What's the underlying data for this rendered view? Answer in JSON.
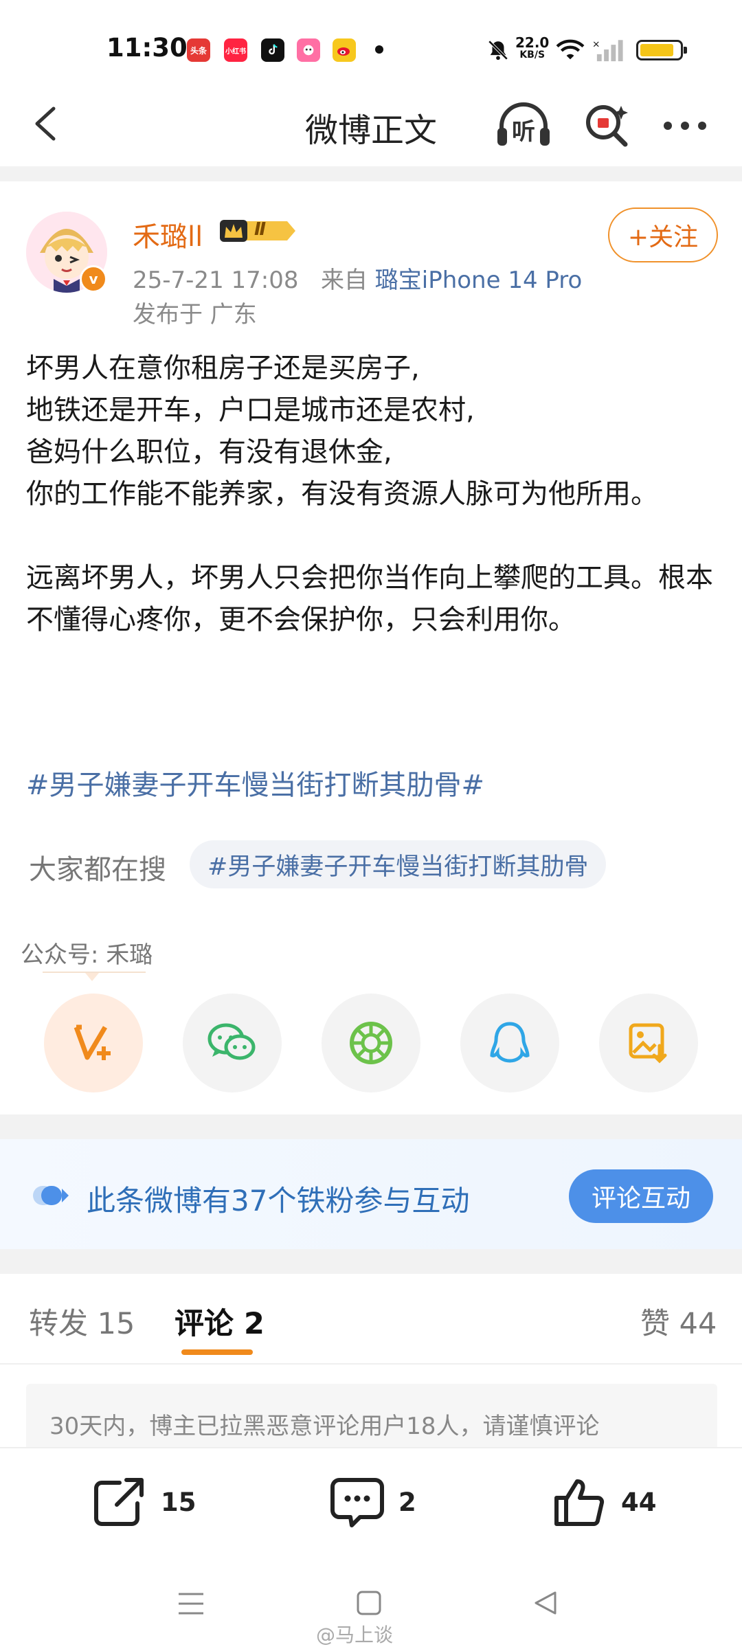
{
  "status_bar": {
    "time": "11:30",
    "apps": [
      "头条",
      "小红书"
    ],
    "speed_value": "22.0",
    "speed_unit": "KB/S",
    "battery_level": 0.85,
    "battery_color": "#f5c518"
  },
  "nav": {
    "title": "微博正文",
    "back_icon": "chevron-left-icon",
    "listen_label": "听",
    "more_icon": "more-dots-icon"
  },
  "post": {
    "username": "禾璐ll",
    "level_badge": "Ⅱ",
    "verified_badge": "v",
    "time": "25-7-21 17:08",
    "source_prefix": "来自",
    "source": "璐宝iPhone 14 Pro",
    "location": "发布于 广东",
    "follow_label": "+关注",
    "body": "坏男人在意你租房子还是买房子,\n地铁还是开车，户口是城市还是农村,\n爸妈什么职位，有没有退休金,\n你的工作能不能养家，有没有资源人脉可为他所用。\n\n远离坏男人，坏男人只会把你当作向上攀爬的工具。根本不懂得心疼你，更不会保护你，只会利用你。",
    "topic": "#男子嫌妻子开车慢当街打断其肋骨#",
    "search_label": "大家都在搜",
    "search_chip": "#男子嫌妻子开车慢当街打断其肋骨",
    "public_account": "公众号: 禾璐"
  },
  "share_icons": [
    "weibo-share-icon",
    "wechat-icon",
    "moments-icon",
    "qq-icon",
    "save-image-icon"
  ],
  "fans_banner": {
    "text": "此条微博有37个铁粉参与互动",
    "button": "评论互动"
  },
  "tabs": {
    "repost": "转发 15",
    "comment": "评论 2",
    "like": "赞 44"
  },
  "notice": "30天内，博主已拉黑恶意评论用户18人，请谨慎评论",
  "actions": {
    "repost_count": "15",
    "comment_count": "2",
    "like_count": "44"
  },
  "watermark": "@马上谈",
  "colors": {
    "accent_orange": "#f08a1c",
    "link_blue": "#4a6fa5",
    "banner_blue": "#4d90e8"
  }
}
